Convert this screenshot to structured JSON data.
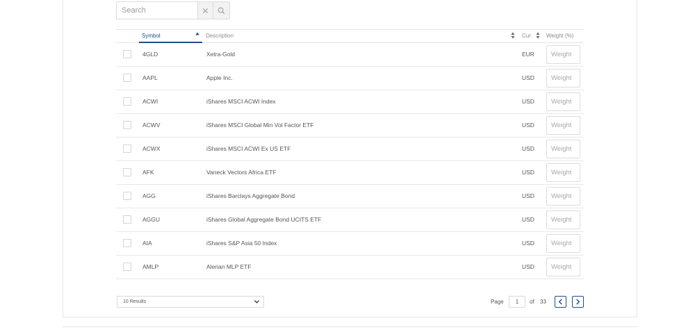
{
  "search": {
    "placeholder": "Search",
    "value": "",
    "icons": {
      "clear": "close-icon",
      "submit": "search-icon"
    }
  },
  "table": {
    "headers": {
      "symbol": "Symbol",
      "description": "Description",
      "currency": "Cur",
      "weight": "Weight (%)"
    },
    "weight_placeholder": "Weight",
    "rows": [
      {
        "symbol": "4GLD",
        "description": "Xetra-Gold",
        "currency": "EUR"
      },
      {
        "symbol": "AAPL",
        "description": "Apple Inc.",
        "currency": "USD"
      },
      {
        "symbol": "ACWI",
        "description": "iShares MSCI ACWI Index",
        "currency": "USD"
      },
      {
        "symbol": "ACWV",
        "description": "iShares MSCI Global Min Vol Factor ETF",
        "currency": "USD"
      },
      {
        "symbol": "ACWX",
        "description": "iShares MSCI ACWI Ex US ETF",
        "currency": "USD"
      },
      {
        "symbol": "AFK",
        "description": "Vaneck Vectors Africa ETF",
        "currency": "USD"
      },
      {
        "symbol": "AGG",
        "description": "iShares Barclays Aggregate Bond",
        "currency": "USD"
      },
      {
        "symbol": "AGGU",
        "description": "iShares Global Aggregate Bond UCITS ETF",
        "currency": "USD"
      },
      {
        "symbol": "AIA",
        "description": "iShares S&P Asia 50 Index",
        "currency": "USD"
      },
      {
        "symbol": "AMLP",
        "description": "Alerian MLP ETF",
        "currency": "USD"
      }
    ]
  },
  "footer": {
    "results_label": "10 Results",
    "page_label": "Page",
    "current_page": "1",
    "of_label": "of",
    "total_pages": "33"
  },
  "colors": {
    "accent": "#1f4d86",
    "border": "#e3e3e3"
  }
}
